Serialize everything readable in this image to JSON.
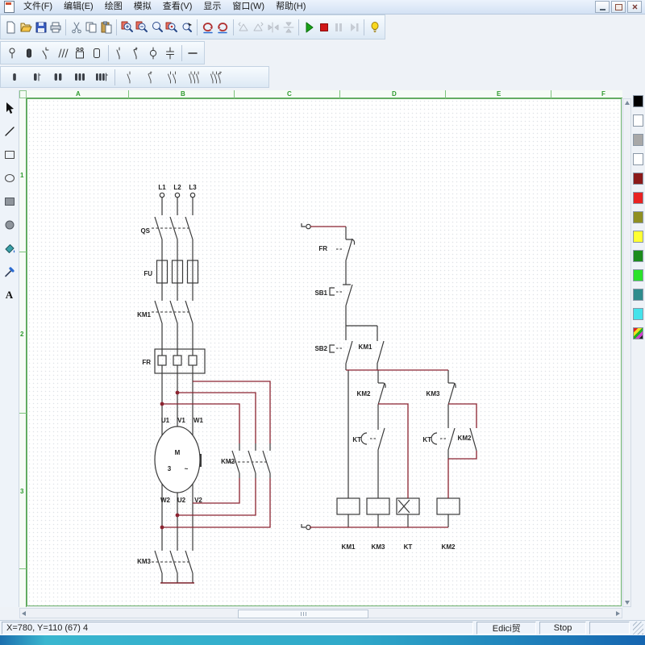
{
  "window": {
    "menu_items": [
      "文件(F)",
      "编辑(E)",
      "绘图",
      "模拟",
      "查看(V)",
      "显示",
      "窗口(W)",
      "帮助(H)"
    ],
    "controls": [
      "minimize",
      "restore",
      "close"
    ]
  },
  "toolbar_main": {
    "items": [
      "new",
      "open",
      "save",
      "print",
      "cut",
      "copy",
      "paste",
      "zoom-in",
      "zoom-out",
      "zoom-region",
      "zoom-selection",
      "zoom-pointer",
      "undo",
      "redo",
      "rotate-left",
      "rotate-right",
      "flip-horizontal",
      "flip-vertical",
      "run",
      "stop",
      "pause",
      "step",
      "help"
    ]
  },
  "toolbar_components": {
    "items": [
      "probe",
      "battery",
      "knife-switch",
      "triple-switch",
      "relay",
      "component-box",
      "contact",
      "contact-variant",
      "circle-component",
      "capacitor",
      "dash-line"
    ]
  },
  "toolbar_coils": {
    "items": [
      "coil",
      "coil-with-pin",
      "coil-pair",
      "coil-triple",
      "coil-quad",
      "contact-single",
      "contact-single-variant",
      "contact-double",
      "contact-triple",
      "contact-triple-variant"
    ]
  },
  "tool_palette": {
    "items": [
      "select",
      "line",
      "rectangle",
      "ellipse",
      "filled-rectangle",
      "filled-circle",
      "fill",
      "color-picker",
      "text"
    ],
    "text_glyph": "A"
  },
  "color_palette": {
    "swatches": [
      "#000000",
      "#ffffff",
      "#a8a8a8",
      "#ffffff",
      "#8b1a1a",
      "#e82222",
      "#8f8f22",
      "#ffff33",
      "#1c8c1c",
      "#2ae22a",
      "#2e8c8c",
      "#44e2ea"
    ],
    "rainbow": "multicolor"
  },
  "rulers": {
    "top": [
      "A",
      "B",
      "C",
      "D",
      "E",
      "F"
    ],
    "left": [
      "1",
      "2",
      "3"
    ],
    "color": "#2e9a2e"
  },
  "circuit": {
    "wire_color": "#8b2330",
    "line_color": "#3a3a3a",
    "power": {
      "l1": "L1",
      "l2": "L2",
      "l3": "L3",
      "qs": "QS",
      "fu": "FU",
      "km1": "KM1",
      "fr": "FR",
      "u1": "U1",
      "v1": "V1",
      "w1": "W1",
      "motor_m": "M",
      "motor_3": "3",
      "motor_wave": "~",
      "w2": "W2",
      "u2": "U2",
      "v2": "V2",
      "km2": "KM2",
      "km3": "KM3"
    },
    "control": {
      "fr": "FR",
      "sb1": "SB1",
      "sb2": "SB2",
      "km1": "KM1",
      "km2_nc": "KM2",
      "km3_nc": "KM3",
      "kt_left": "KT",
      "kt_right": "KT",
      "km2_no": "KM2",
      "coil_km1": "KM1",
      "coil_km3": "KM3",
      "coil_kt": "KT",
      "coil_km2": "KM2"
    }
  },
  "status_bar": {
    "position": "X=780, Y=110 (67) 4",
    "mode": "Edici贸",
    "state": "Stop"
  }
}
